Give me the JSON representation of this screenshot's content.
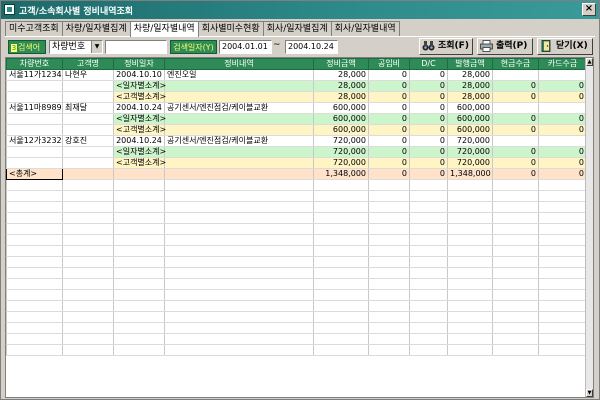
{
  "window": {
    "title": "고객/소속회사별 정비내역조회",
    "close_label": "×"
  },
  "tabs": [
    {
      "label": "미수고객조회"
    },
    {
      "label": "차량/일자별집계"
    },
    {
      "label": "차량/일자별내역"
    },
    {
      "label": "회사별미수현황"
    },
    {
      "label": "회사/일자별집계"
    },
    {
      "label": "회사/일자별내역"
    }
  ],
  "toolbar": {
    "search_label": "검색어",
    "search_type_value": "차량번호",
    "search_text_value": "",
    "date_label": "검색일자(Y)",
    "date_from": "2004.01.01",
    "date_sep": "~",
    "date_to": "2004.10.24",
    "query_button": "조회(F)",
    "print_button": "출력(P)",
    "close_button": "닫기(X)"
  },
  "grid": {
    "columns": [
      "차량번호",
      "고객명",
      "정비일자",
      "정비내역",
      "정비금액",
      "공임비",
      "D/C",
      "발행금액",
      "현금수금",
      "카드수금"
    ],
    "rows": [
      {
        "type": "item",
        "cells": [
          "서울11가1234",
          "나현우",
          "2004.10.10",
          "엔진오일",
          "28,000",
          "0",
          "0",
          "28,000",
          "",
          ""
        ]
      },
      {
        "type": "sub-day",
        "cells": [
          "",
          "",
          "<일자별소계>",
          "",
          "28,000",
          "0",
          "0",
          "28,000",
          "0",
          "0"
        ]
      },
      {
        "type": "sub-cust",
        "cells": [
          "",
          "",
          "<고객별소계>",
          "",
          "28,000",
          "0",
          "0",
          "28,000",
          "0",
          "0"
        ]
      },
      {
        "type": "item",
        "cells": [
          "서울11마8989",
          "최재달",
          "2004.10.24",
          "공기센서/엔진점검/케이블교환",
          "600,000",
          "0",
          "0",
          "600,000",
          "",
          ""
        ]
      },
      {
        "type": "sub-day",
        "cells": [
          "",
          "",
          "<일자별소계>",
          "",
          "600,000",
          "0",
          "0",
          "600,000",
          "0",
          "0"
        ]
      },
      {
        "type": "sub-cust",
        "cells": [
          "",
          "",
          "<고객별소계>",
          "",
          "600,000",
          "0",
          "0",
          "600,000",
          "0",
          "0"
        ]
      },
      {
        "type": "item",
        "cells": [
          "서울12가3232",
          "강호진",
          "2004.10.24",
          "공기센서/엔진점검/케이블교환",
          "720,000",
          "0",
          "0",
          "720,000",
          "",
          ""
        ]
      },
      {
        "type": "sub-day",
        "cells": [
          "",
          "",
          "<일자별소계>",
          "",
          "720,000",
          "0",
          "0",
          "720,000",
          "0",
          "0"
        ]
      },
      {
        "type": "sub-cust",
        "cells": [
          "",
          "",
          "<고객별소계>",
          "",
          "720,000",
          "0",
          "0",
          "720,000",
          "0",
          "0"
        ]
      },
      {
        "type": "total",
        "cells": [
          "<총계>",
          "",
          "",
          "",
          "1,348,000",
          "0",
          "0",
          "1,348,000",
          "0",
          "0"
        ]
      }
    ],
    "empty_rows": 16
  }
}
